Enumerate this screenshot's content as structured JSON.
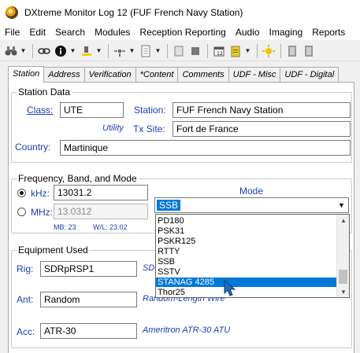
{
  "window": {
    "title": "DXtreme Monitor Log 12 (FUF French Navy Station)"
  },
  "menu": [
    "File",
    "Edit",
    "Search",
    "Modules",
    "Reception Reporting",
    "Audio",
    "Imaging",
    "Reports"
  ],
  "toolbar": {
    "icons": [
      "binoculars-icon",
      "link-icon",
      "info-icon",
      "highlighter-icon",
      "satellite-icon",
      "document-icon",
      "note-icon",
      "stop-icon",
      "calendar-icon",
      "clipboard-icon",
      "sun-icon",
      "book-icon",
      "book2-icon"
    ]
  },
  "tabs": [
    "Station",
    "Address",
    "Verification",
    "*Content",
    "Comments",
    "UDF - Misc",
    "UDF - Digital"
  ],
  "station_data": {
    "title": "Station Data",
    "class_label": "Class:",
    "class_value": "UTE",
    "station_label": "Station:",
    "station_value": "FUF French Navy Station",
    "class_desc": "Utility",
    "tx_site_label": "Tx Site:",
    "tx_site_value": "Fort de France",
    "country_label": "Country:",
    "country_value": "Martinique"
  },
  "frequency": {
    "title": "Frequency, Band, and Mode",
    "khz_label": "kHz:",
    "khz_value": "13031.2",
    "mhz_label": "MHz:",
    "mhz_value": "13.0312",
    "mb_text": "MB: 23",
    "wl_text": "W/L: 23.02",
    "mode_label": "Mode",
    "mode_value": "SSB",
    "mode_options": [
      "PD180",
      "PSK31",
      "PSKR125",
      "RTTY",
      "SSB",
      "SSTV",
      "STANAG 4285",
      "Thor25"
    ],
    "highlighted_option": "STANAG 4285"
  },
  "equipment": {
    "title": "Equipment Used",
    "rig_label": "Rig:",
    "rig_value": "SDRpRSP1",
    "rig_desc_partial": "SD",
    "ant_label": "Ant:",
    "ant_value": "Random",
    "ant_desc": "Random-Length Wire",
    "acc_label": "Acc:",
    "acc_value": "ATR-30",
    "acc_desc": "Ameritron ATR-30 ATU"
  },
  "colors": {
    "label_blue": "#1a3faf",
    "selection": "#0078d7"
  }
}
